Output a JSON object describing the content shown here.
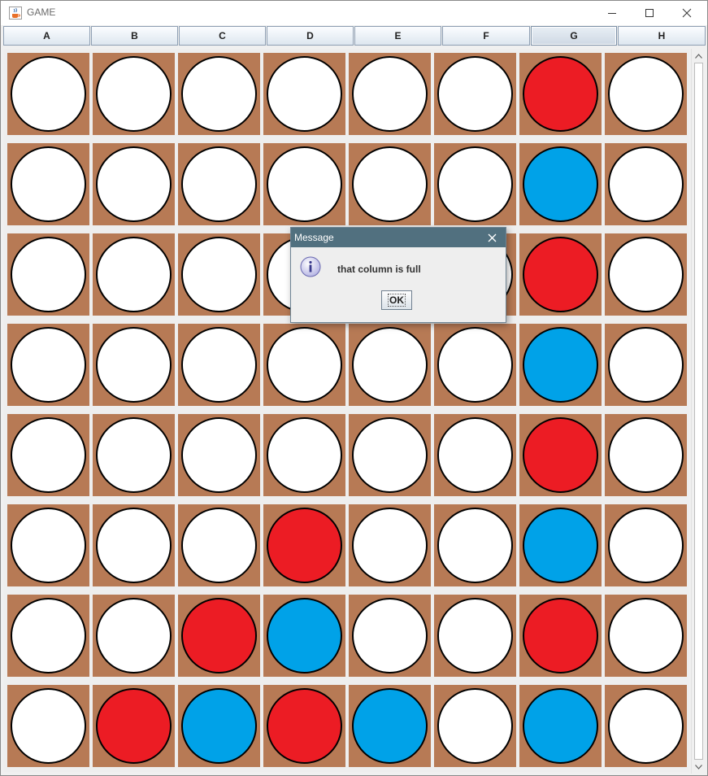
{
  "window": {
    "title": "GAME",
    "icon": "java-cup-icon",
    "controls": [
      "minimize-icon",
      "maximize-icon",
      "close-icon"
    ]
  },
  "columns": {
    "labels": [
      "A",
      "B",
      "C",
      "D",
      "E",
      "F",
      "G",
      "H"
    ],
    "selected": "G"
  },
  "board": {
    "rows": 8,
    "cols": 8,
    "grid": [
      [
        "empty",
        "empty",
        "empty",
        "empty",
        "empty",
        "empty",
        "red",
        "empty"
      ],
      [
        "empty",
        "empty",
        "empty",
        "empty",
        "empty",
        "empty",
        "blue",
        "empty"
      ],
      [
        "empty",
        "empty",
        "empty",
        "empty",
        "empty",
        "empty",
        "red",
        "empty"
      ],
      [
        "empty",
        "empty",
        "empty",
        "empty",
        "empty",
        "empty",
        "blue",
        "empty"
      ],
      [
        "empty",
        "empty",
        "empty",
        "empty",
        "empty",
        "empty",
        "red",
        "empty"
      ],
      [
        "empty",
        "empty",
        "empty",
        "red",
        "empty",
        "empty",
        "blue",
        "empty"
      ],
      [
        "empty",
        "empty",
        "red",
        "blue",
        "empty",
        "empty",
        "red",
        "empty"
      ],
      [
        "empty",
        "red",
        "blue",
        "red",
        "blue",
        "empty",
        "blue",
        "empty"
      ]
    ],
    "colors": {
      "empty": "#ffffff",
      "red": "#ec1c24",
      "blue": "#00a2e8",
      "cell_bg": "#b77a55"
    }
  },
  "dialog": {
    "title": "Message",
    "message": "that column is full",
    "ok_label": "OK",
    "icon": "info-icon"
  }
}
